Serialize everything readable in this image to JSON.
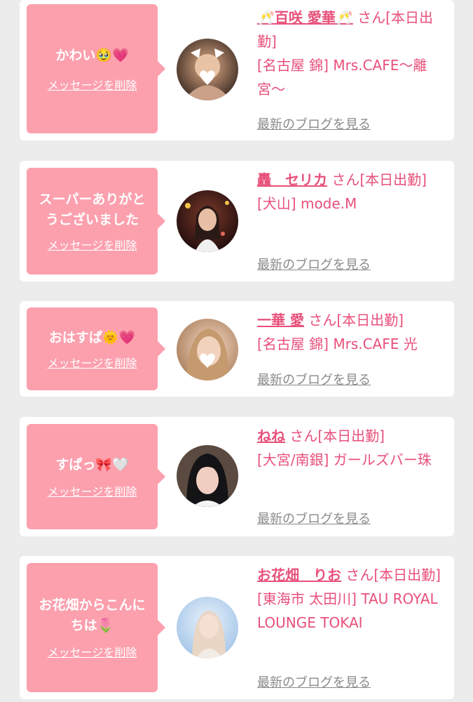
{
  "messages": [
    {
      "message": "かわい🥹💗",
      "delete_label": "メッセージを削除",
      "name_prefix": "🥂",
      "name": "百咲 愛華",
      "name_suffix": "🥂",
      "honorific": "さん",
      "status": "[本日出勤]",
      "shop": "[名古屋 錦] Mrs.CAFE〜離宮〜",
      "blog_link": "最新のブログを見る",
      "avatar_colors": [
        "#3a2a22",
        "#c98f6a"
      ]
    },
    {
      "message": "スーパーありがとうございました",
      "delete_label": "メッセージを削除",
      "name_prefix": "",
      "name": "轟　セリカ",
      "name_suffix": "",
      "honorific": "さん",
      "status": "[本日出勤]",
      "shop": "[犬山] mode.M",
      "blog_link": "最新のブログを見る",
      "avatar_colors": [
        "#2a1014",
        "#d8a080"
      ]
    },
    {
      "message": "おはすぱ🌞💗",
      "delete_label": "メッセージを削除",
      "name_prefix": "",
      "name": "一華 愛",
      "name_suffix": "",
      "honorific": "さん",
      "status": "[本日出勤]",
      "shop": "[名古屋 錦] Mrs.CAFE 光",
      "blog_link": "最新のブログを見る",
      "avatar_colors": [
        "#c79a72",
        "#f0d2b8"
      ]
    },
    {
      "message": "すぱっ🎀🤍",
      "delete_label": "メッセージを削除",
      "name_prefix": "",
      "name": "ねね",
      "name_suffix": "",
      "honorific": "さん",
      "status": "[本日出勤]",
      "shop": "[大宮/南銀] ガールズバー珠",
      "blog_link": "最新のブログを見る",
      "avatar_colors": [
        "#1b1b1f",
        "#e8c0b2"
      ]
    },
    {
      "message": "お花畑からこんにちは🌷",
      "delete_label": "メッセージを削除",
      "name_prefix": "",
      "name": "お花畑　りお",
      "name_suffix": "",
      "honorific": "さん",
      "status": "[本日出勤]",
      "shop": "[東海市 太田川] TAU ROYAL LOUNGE TOKAI",
      "blog_link": "最新のブログを見る",
      "avatar_colors": [
        "#a8c8ec",
        "#f2dbcf"
      ]
    }
  ]
}
